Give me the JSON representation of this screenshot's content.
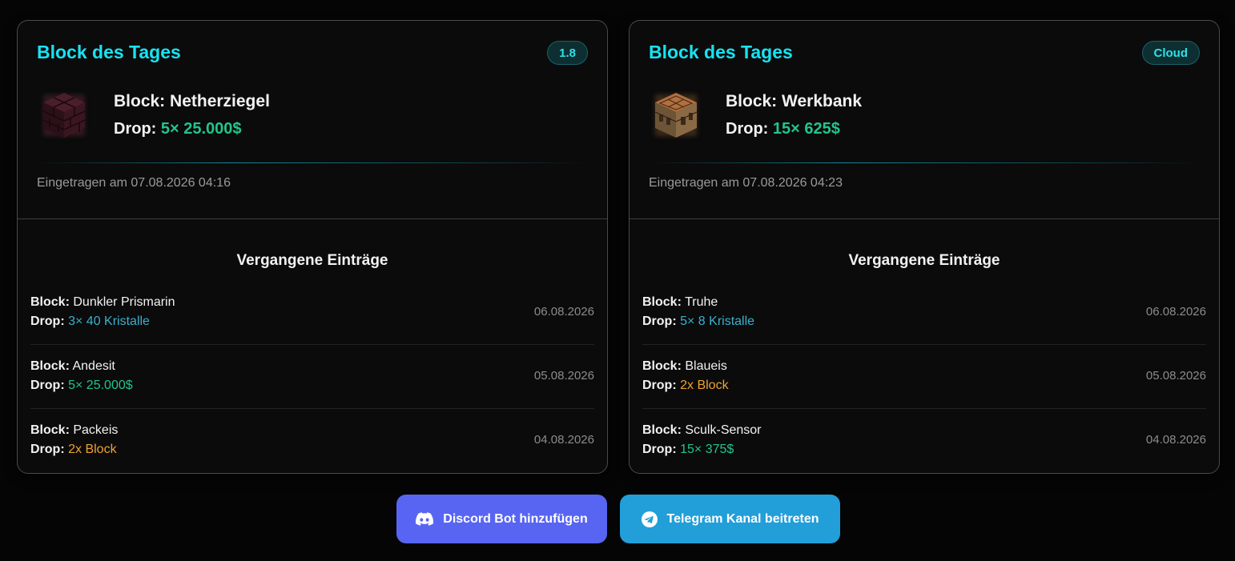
{
  "cards": [
    {
      "title": "Block des Tages",
      "badge": "1.8",
      "block_label": "Block:",
      "block_name": "Netherziegel",
      "drop_label": "Drop:",
      "drop_value": "5× 25.000$",
      "block_icon": "nether-bricks-block-icon",
      "entered": "Eingetragen am 07.08.2026 04:16",
      "history_title": "Vergangene Einträge",
      "history": [
        {
          "block_label": "Block:",
          "block": "Dunkler Prismarin",
          "drop_label": "Drop:",
          "drop": "3× 40 Kristalle",
          "date": "06.08.2026"
        },
        {
          "block_label": "Block:",
          "block": "Andesit",
          "drop_label": "Drop:",
          "drop": "5× 25.000$",
          "date": "05.08.2026"
        },
        {
          "block_label": "Block:",
          "block": "Packeis",
          "drop_label": "Drop:",
          "drop": "2x Block",
          "date": "04.08.2026"
        }
      ]
    },
    {
      "title": "Block des Tages",
      "badge": "Cloud",
      "block_label": "Block:",
      "block_name": "Werkbank",
      "drop_label": "Drop:",
      "drop_value": "15× 625$",
      "block_icon": "crafting-table-block-icon",
      "entered": "Eingetragen am 07.08.2026 04:23",
      "history_title": "Vergangene Einträge",
      "history": [
        {
          "block_label": "Block:",
          "block": "Truhe",
          "drop_label": "Drop:",
          "drop": "5× 8 Kristalle",
          "date": "06.08.2026"
        },
        {
          "block_label": "Block:",
          "block": "Blaueis",
          "drop_label": "Drop:",
          "drop": "2x Block",
          "date": "05.08.2026"
        },
        {
          "block_label": "Block:",
          "block": "Sculk-Sensor",
          "drop_label": "Drop:",
          "drop": "15× 375$",
          "date": "04.08.2026"
        }
      ]
    }
  ],
  "buttons": {
    "discord_label": "Discord Bot hinzufügen",
    "discord_icon": "discord-icon",
    "telegram_label": "Telegram Kanal beitreten",
    "telegram_icon": "telegram-icon"
  },
  "colors": {
    "title_cyan": "#17e3f2",
    "drop_green": "#22c58a",
    "drop_teal": "#3bb0ce",
    "drop_orange": "#eea233",
    "discord": "#5865f2",
    "telegram": "#229ed9"
  }
}
